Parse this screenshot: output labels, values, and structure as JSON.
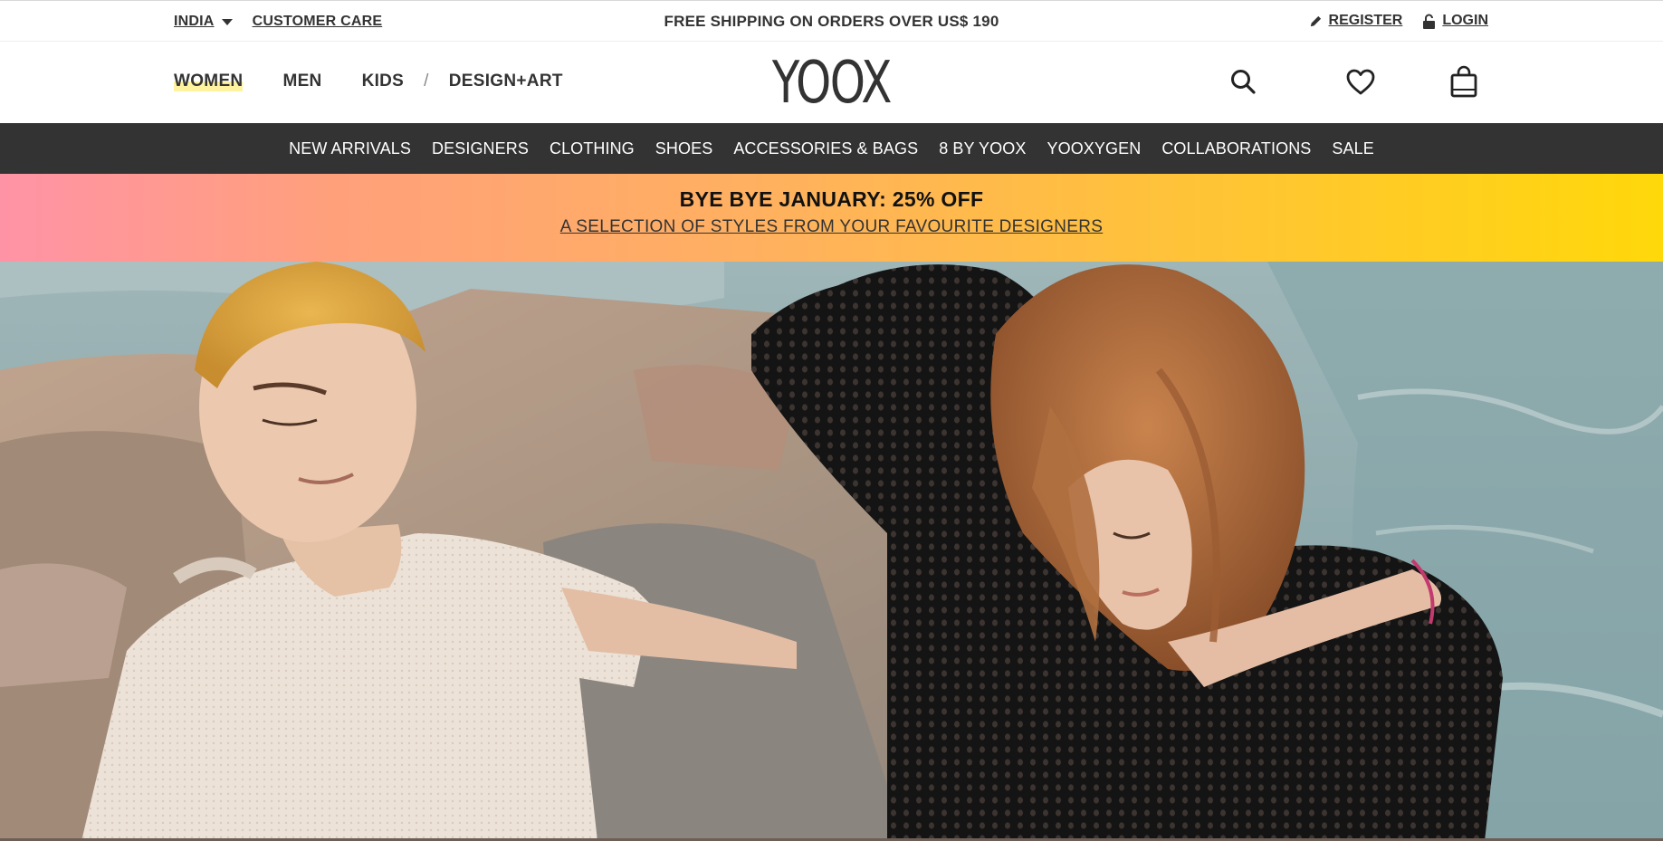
{
  "utility": {
    "country": "INDIA",
    "customer_care": "CUSTOMER CARE",
    "shipping_message": "FREE SHIPPING ON ORDERS OVER US$ 190",
    "register": "REGISTER",
    "login": "LOGIN"
  },
  "header": {
    "logo": "YOOX",
    "genders": [
      "WOMEN",
      "MEN",
      "KIDS"
    ],
    "separator": "/",
    "design_art": "DESIGN+ART",
    "active_gender": "WOMEN"
  },
  "categories": [
    "NEW ARRIVALS",
    "DESIGNERS",
    "CLOTHING",
    "SHOES",
    "ACCESSORIES & BAGS",
    "8 BY YOOX",
    "YOOXYGEN",
    "COLLABORATIONS",
    "SALE"
  ],
  "promo": {
    "headline": "BYE BYE JANUARY: 25% OFF",
    "subline": "A SELECTION OF STYLES FROM YOUR FAVOURITE DESIGNERS"
  },
  "icons": {
    "search": "search-icon",
    "wishlist": "heart-icon",
    "bag": "shopping-bag-icon",
    "register": "pencil-icon",
    "login": "unlock-icon",
    "country": "caret-down-icon"
  },
  "colors": {
    "category_bar": "#333333",
    "promo_gradient_start": "#ff93a6",
    "promo_gradient_end": "#ffd80a",
    "active_highlight": "#fff3a0"
  }
}
